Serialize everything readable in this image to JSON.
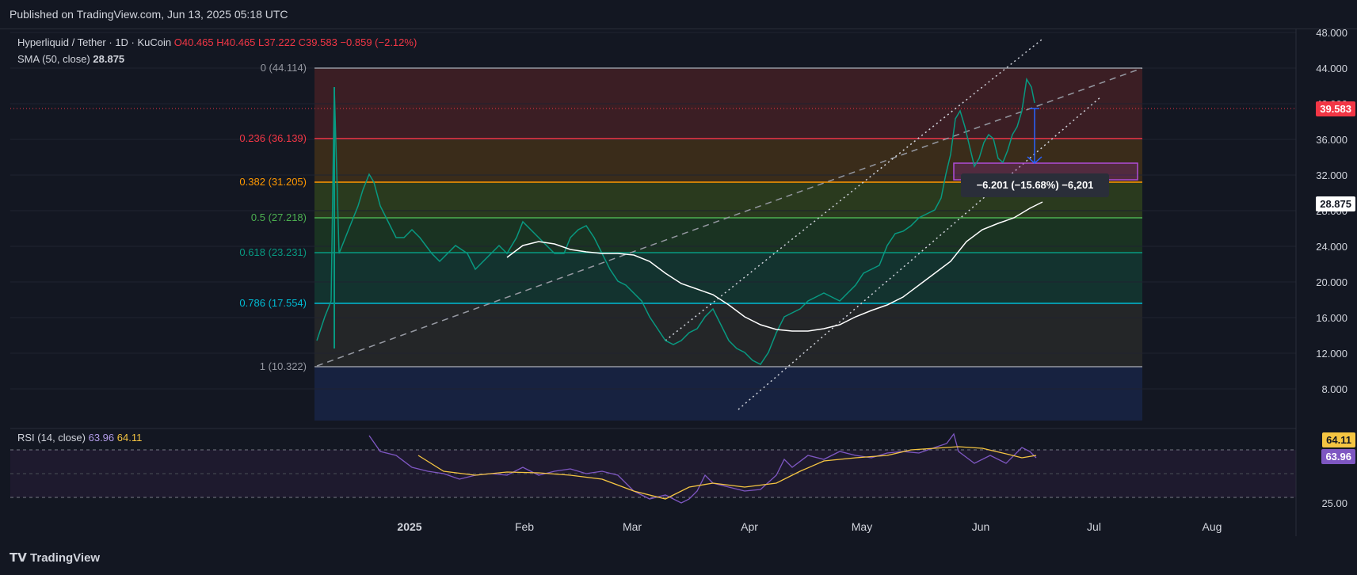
{
  "header": {
    "published": "Published on TradingView.com, Jun 13, 2025 05:18 UTC"
  },
  "legend": {
    "symbol": "Hyperliquid / Tether · 1D · KuCoin",
    "open": "O40.465",
    "high": "H40.465",
    "low": "L37.222",
    "close": "C39.583",
    "change": "−0.859 (−2.12%)",
    "sma_label": "SMA (50, close)",
    "sma_value": "28.875",
    "rsi_label": "RSI (14, close)",
    "rsi_value": "63.96",
    "rsi_ma_value": "64.11"
  },
  "fib_levels": [
    {
      "label": "0 (44.114)",
      "color": "#787b86"
    },
    {
      "label": "0.236 (36.139)",
      "color": "#f23645"
    },
    {
      "label": "0.382 (31.205)",
      "color": "#ff9800"
    },
    {
      "label": "0.5 (27.218)",
      "color": "#4caf50"
    },
    {
      "label": "0.618 (23.231)",
      "color": "#089981"
    },
    {
      "label": "0.786 (17.554)",
      "color": "#00bcd4"
    },
    {
      "label": "1 (10.322)",
      "color": "#787b86"
    }
  ],
  "price_axis": [
    "48.000",
    "44.000",
    "40.000",
    "36.000",
    "32.000",
    "28.000",
    "24.000",
    "20.000",
    "16.000",
    "12.000",
    "8.000"
  ],
  "price_tags": {
    "last": "39.583",
    "sma": "28.875",
    "rsi_ma": "64.11",
    "rsi": "63.96"
  },
  "rsi_axis": {
    "bottom": "25.00"
  },
  "time_axis": [
    "2025",
    "Feb",
    "Mar",
    "Apr",
    "May",
    "Jun",
    "Jul",
    "Aug"
  ],
  "measure": {
    "text": "−6.201 (−15.68%) −6,201"
  },
  "footer": {
    "brand": "TradingView"
  },
  "colors": {
    "up": "#089981",
    "down": "#f23645",
    "sma": "#ffffff",
    "rsi": "#7e57c2",
    "rsi_ma": "#f5c542",
    "bg": "#131722"
  }
}
